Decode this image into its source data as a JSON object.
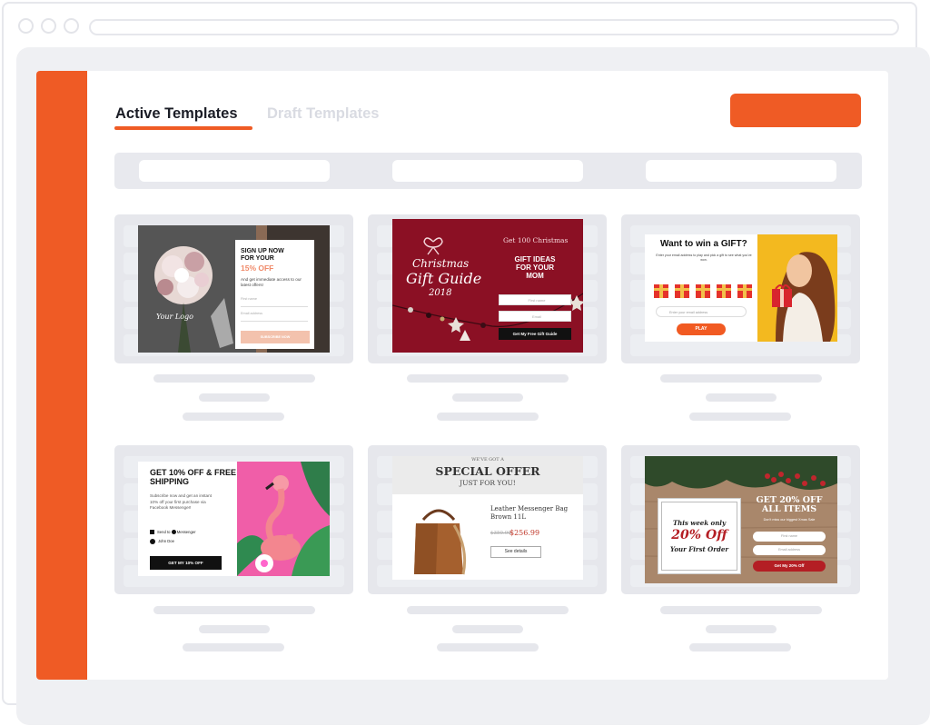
{
  "tabs": {
    "active": "Active Templates",
    "draft": "Draft Templates"
  },
  "colors": {
    "accent": "#ef5b25"
  },
  "templates": [
    {
      "title1": "SIGN UP NOW",
      "title2": "FOR YOUR",
      "highlight": "15% OFF",
      "body": "And get immediate access to our latest offers!",
      "field1": "First name",
      "field2": "Email address",
      "button": "SUBSCRIBE NOW",
      "logo": "Your Logo"
    },
    {
      "script1": "Christmas",
      "script2": "Gift Guide",
      "year": "2018",
      "heading": "Get 100 Christmas",
      "title": "GIFT IDEAS FOR YOUR MOM",
      "field1": "First name",
      "field2": "Email",
      "button": "Get My Free Gift Guide"
    },
    {
      "title": "Want to win a GIFT?",
      "body": "Enter your email address to play and pick a gift to see what you've won.",
      "field": "Enter your email address",
      "button": "PLAY"
    },
    {
      "title": "GET 10% OFF & FREE SHIPPING",
      "body": "Subscribe now and get an instant 10% off your first purchase via Facebook Messenger!",
      "opt1": "Send to",
      "opt1b": "Messenger",
      "opt2": "John Doe",
      "button": "GET MY 10% OFF"
    },
    {
      "small": "WE'VE GOT A",
      "title": "SPECIAL OFFER",
      "sub": "JUST FOR YOU!",
      "product": "Leather Messenger Bag Brown 11L",
      "old_price": "$350.00",
      "price": "$256.99",
      "button": "See details"
    },
    {
      "box1": "This week only",
      "box2": "20% Off",
      "box3": "Your First Order",
      "title": "GET 20% OFF ALL ITEMS",
      "body": "Don't miss our biggest Xmas Sale",
      "field1": "First name",
      "field2": "Email address",
      "button": "Get My 20% Off"
    }
  ]
}
